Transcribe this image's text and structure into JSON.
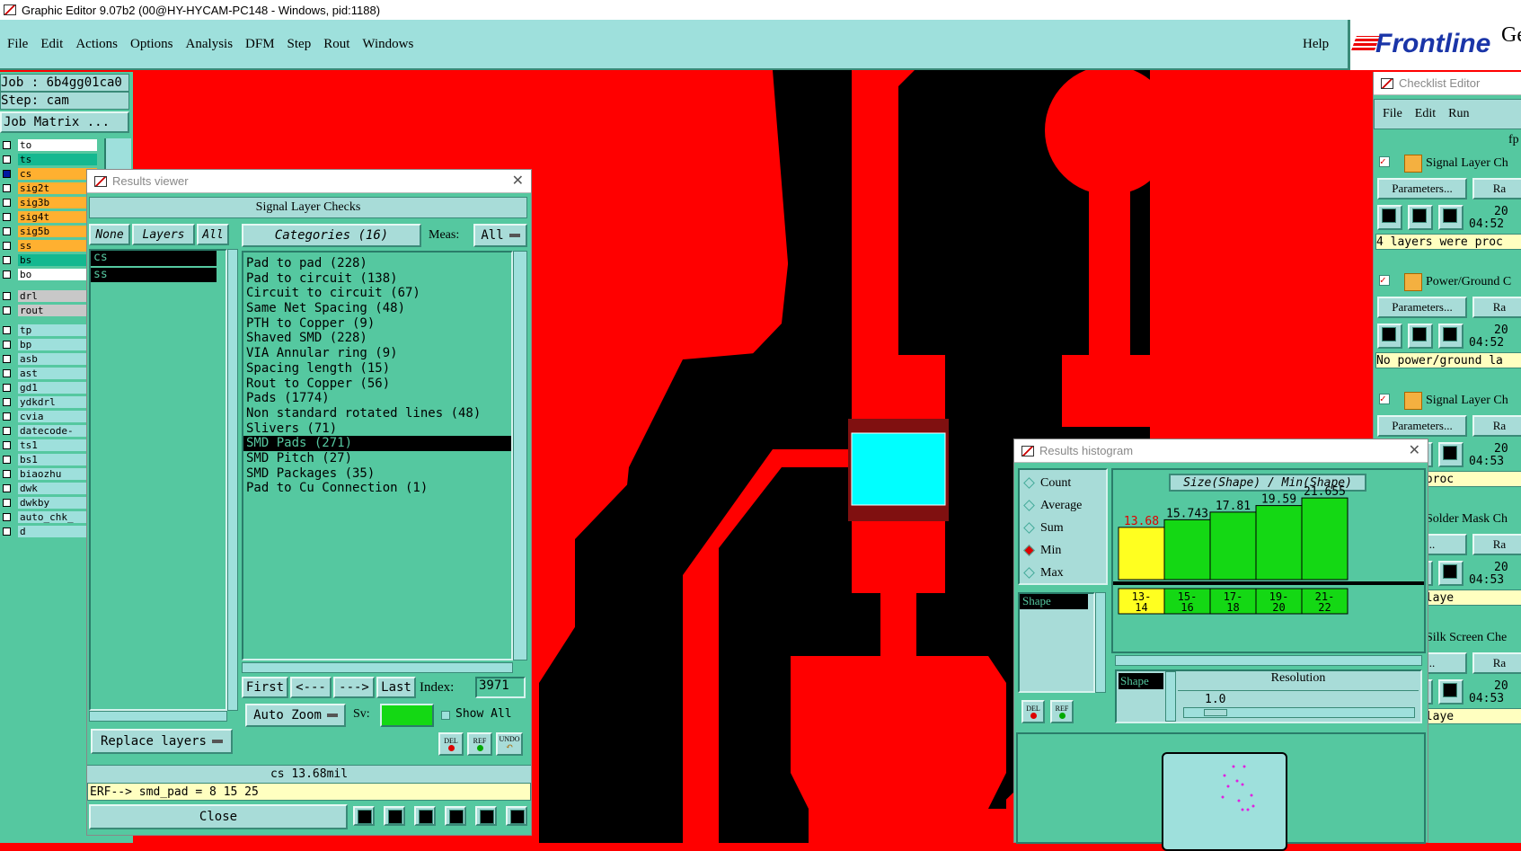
{
  "window": {
    "title": "Graphic Editor 9.07b2 (00@HY-HYCAM-PC148 - Windows, pid:1188)"
  },
  "menu": {
    "items": [
      "File",
      "Edit",
      "Actions",
      "Options",
      "Analysis",
      "DFM",
      "Step",
      "Rout",
      "Windows"
    ],
    "help": "Help"
  },
  "brand": {
    "logo": "Frontline",
    "partial": "Ge"
  },
  "left": {
    "job": "Job : 6b4gg01ca0",
    "step": "Step: cam",
    "job_matrix": "Job Matrix ...",
    "layers": [
      {
        "name": "to",
        "color": "#ffffff"
      },
      {
        "name": "ts",
        "color": "#14b890"
      },
      {
        "name": "cs",
        "color": "#ffb030"
      },
      {
        "name": "sig2t",
        "color": "#ffb030"
      },
      {
        "name": "sig3b",
        "color": "#ffb030"
      },
      {
        "name": "sig4t",
        "color": "#ffb030"
      },
      {
        "name": "sig5b",
        "color": "#ffb030"
      },
      {
        "name": "ss",
        "color": "#ffb030"
      },
      {
        "name": "bs",
        "color": "#14b890"
      },
      {
        "name": "bo",
        "color": "#ffffff"
      },
      {
        "name": "drl",
        "color": "#c8c8c8"
      },
      {
        "name": "rout",
        "color": "#c8c8c8"
      },
      {
        "name": "tp",
        "color": "#9ee0dc"
      },
      {
        "name": "bp",
        "color": "#9ee0dc"
      },
      {
        "name": "asb",
        "color": "#9ee0dc"
      },
      {
        "name": "ast",
        "color": "#9ee0dc"
      },
      {
        "name": "gd1",
        "color": "#9ee0dc"
      },
      {
        "name": "ydkdrl",
        "color": "#9ee0dc"
      },
      {
        "name": "cvia",
        "color": "#9ee0dc"
      },
      {
        "name": "datecode-",
        "color": "#9ee0dc"
      },
      {
        "name": "ts1",
        "color": "#9ee0dc"
      },
      {
        "name": "bs1",
        "color": "#9ee0dc"
      },
      {
        "name": "biaozhu",
        "color": "#9ee0dc"
      },
      {
        "name": "dwk",
        "color": "#9ee0dc"
      },
      {
        "name": "dwkby",
        "color": "#9ee0dc"
      },
      {
        "name": "auto_chk_",
        "color": "#9ee0dc"
      },
      {
        "name": "d",
        "color": "#9ee0dc"
      }
    ]
  },
  "results_viewer": {
    "title": "Results viewer",
    "header": "Signal Layer Checks",
    "none": "None",
    "layers": "Layers",
    "all": "All",
    "layer_list": [
      "cs",
      "ss"
    ],
    "categories_label": "Categories (16)",
    "meas_label": "Meas:",
    "meas_value": "All",
    "categories": [
      "Pad to pad (228)",
      "Pad to circuit (138)",
      "Circuit to circuit (67)",
      "Same Net Spacing (48)",
      "PTH to Copper (9)",
      "Shaved SMD (228)",
      "VIA Annular ring (9)",
      "Spacing length (15)",
      "Rout to Copper (56)",
      "Pads (1774)",
      "Non standard rotated lines (48)",
      "Slivers (71)",
      "SMD Pads (271)",
      "SMD Pitch (27)",
      "SMD Packages (35)",
      "Pad to Cu Connection (1)"
    ],
    "selected_category": 12,
    "first": "First",
    "prev": "<---",
    "next": "--->",
    "last": "Last",
    "index_label": "Index:",
    "index_value": "3971",
    "auto_zoom": "Auto Zoom",
    "sv": "Sv:",
    "show_all": "Show All",
    "replace_layers": "Replace layers",
    "del": "DEL",
    "ref": "REF",
    "undo": "UNDO",
    "status": "cs 13.68mil",
    "erf": "ERF--> smd_pad = 8 15 25",
    "close": "Close"
  },
  "histogram": {
    "title": "Results histogram",
    "options": [
      "Count",
      "Average",
      "Sum",
      "Min",
      "Max"
    ],
    "selected": "Min",
    "list": [
      "Shape"
    ],
    "chart_title": "Size(Shape) / Min(Shape)",
    "del": "DEL",
    "ref": "REF",
    "res_label": "Shape",
    "resolution_label": "Resolution",
    "resolution": "1.0"
  },
  "chart_data": {
    "type": "bar",
    "title": "Size(Shape) / Min(Shape)",
    "categories": [
      "13-14",
      "15-16",
      "17-18",
      "19-20",
      "21-22"
    ],
    "values": [
      13.68,
      15.743,
      17.81,
      19.59,
      21.655
    ],
    "value_labels": [
      "13.68",
      "15.743",
      "17.81",
      "19.59",
      "21.655"
    ],
    "colors": [
      "#ffff20",
      "#14d814",
      "#14d814",
      "#14d814",
      "#14d814"
    ],
    "label_colors": [
      "#e00000",
      "#000000",
      "#000000",
      "#000000",
      "#000000"
    ],
    "ylim": [
      0,
      23
    ]
  },
  "checklist": {
    "title": "Checklist Editor",
    "menu": [
      "File",
      "Edit",
      "Run"
    ],
    "fp": "fp",
    "items": [
      {
        "name": "Signal Layer Ch",
        "date": "20",
        "time": "04:52",
        "msg": "4 layers were proc",
        "params": "Parameters...",
        "ra": "Ra"
      },
      {
        "name": "Power/Ground C",
        "date": "20",
        "time": "04:52",
        "msg": "No power/ground la",
        "params": "Parameters...",
        "ra": "Ra"
      },
      {
        "name": "Signal Layer Ch",
        "date": "20",
        "time": "04:53",
        "msg": "s were proc",
        "params": "Parameters...",
        "ra": "Ra"
      },
      {
        "name": "Solder Mask Ch",
        "date": "20",
        "time": "04:53",
        "msg": "r Mask laye",
        "params": "ters...",
        "ra": "Ra"
      },
      {
        "name": "Silk Screen Che",
        "date": "20",
        "time": "04:53",
        "msg": "Screen laye",
        "params": "ters...",
        "ra": "Ra"
      }
    ]
  }
}
